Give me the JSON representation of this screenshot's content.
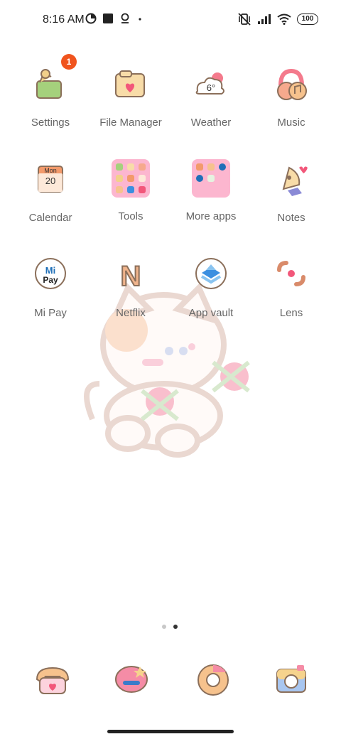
{
  "status_bar": {
    "time": "8:16 AM",
    "battery": "100",
    "icons": [
      "data-saver-icon",
      "square-notification-icon",
      "location-icon",
      "dot-icon",
      "vibrate-off-icon",
      "signal-icon",
      "wifi-icon",
      "battery-icon"
    ]
  },
  "apps": [
    {
      "label": "Settings",
      "icon": "settings-icon",
      "badge": "1"
    },
    {
      "label": "File Manager",
      "icon": "file-manager-icon"
    },
    {
      "label": "Weather",
      "icon": "weather-icon",
      "temp": "6°"
    },
    {
      "label": "Music",
      "icon": "music-icon"
    },
    {
      "label": "Calendar",
      "icon": "calendar-icon",
      "day": "Mon",
      "date": "20"
    },
    {
      "label": "Tools",
      "icon": "tools-folder-icon"
    },
    {
      "label": "More apps",
      "icon": "more-apps-folder-icon"
    },
    {
      "label": "Notes",
      "icon": "notes-icon"
    },
    {
      "label": "Mi Pay",
      "icon": "mi-pay-icon",
      "logo_top": "Mi",
      "logo_bottom": "Pay"
    },
    {
      "label": "Netflix",
      "icon": "netflix-icon",
      "logo": "N"
    },
    {
      "label": "App vault",
      "icon": "app-vault-icon"
    },
    {
      "label": "Lens",
      "icon": "lens-icon"
    }
  ],
  "page_indicator": {
    "pages": 2,
    "current": 2
  },
  "dock": [
    {
      "icon": "phone-icon"
    },
    {
      "icon": "messages-icon"
    },
    {
      "icon": "chrome-icon"
    },
    {
      "icon": "camera-icon"
    }
  ],
  "colors": {
    "badge": "#f0541e",
    "folder": "#fcb6cf",
    "label": "#666666"
  }
}
